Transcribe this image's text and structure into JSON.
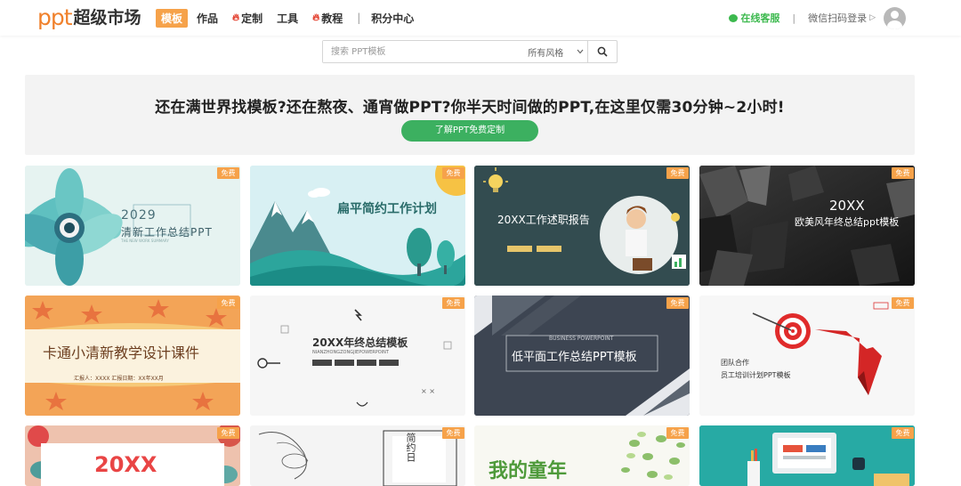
{
  "header": {
    "logo_ppt": "ppt",
    "logo_name": "超级市场",
    "nav": [
      {
        "label": "模板",
        "active": true,
        "hot": false
      },
      {
        "label": "作品",
        "active": false,
        "hot": false
      },
      {
        "label": "定制",
        "active": false,
        "hot": true
      },
      {
        "label": "工具",
        "active": false,
        "hot": false
      },
      {
        "label": "教程",
        "active": false,
        "hot": true
      },
      {
        "label": "积分中心",
        "active": false,
        "hot": false
      }
    ],
    "service_label": "在线客服",
    "separator": "|",
    "login_label": "微信扫码登录",
    "login_arrow": "▷"
  },
  "search": {
    "placeholder": "搜索 PPT模板",
    "style_select": "所有风格"
  },
  "banner": {
    "title": "还在满世界找模板?还在熬夜、通宵做PPT?你半天时间做的PPT,在这里仅需30分钟~2小时!",
    "button_label": "了解PPT免费定制"
  },
  "badge_label": "免费",
  "cards": [
    {
      "title": "2029",
      "subtitle": "清新工作总结PPT",
      "extra": "THE NEW WORK SUMMARY"
    },
    {
      "title": "扁平简约工作计划",
      "subtitle": "",
      "extra": ""
    },
    {
      "title": "20XX工作述职报告",
      "subtitle": "",
      "extra": ""
    },
    {
      "title": "20XX",
      "subtitle": "欧美风年终总结ppt模板",
      "extra": ""
    },
    {
      "title": "卡通小清新教学设计课件",
      "subtitle": "汇报人：XXXX    汇报日期：XX年XX月",
      "extra": ""
    },
    {
      "title": "20XX年终总结模板",
      "subtitle": "NIANZHONGZONGJIEPOWERPOINT",
      "extra": ""
    },
    {
      "title": "低平面工作总结PPT模板",
      "subtitle": "BUSINESS POWERPOINT",
      "extra": ""
    },
    {
      "title": "团队合作",
      "subtitle": "员工培训计划PPT模板",
      "extra": ""
    },
    {
      "title": "20XX",
      "subtitle": "",
      "extra": ""
    },
    {
      "title": "简约日",
      "subtitle": "",
      "extra": ""
    },
    {
      "title": "我的童年",
      "subtitle": "",
      "extra": ""
    },
    {
      "title": "",
      "subtitle": "",
      "extra": ""
    }
  ],
  "colors": {
    "accent_orange": "#f6a24a",
    "logo_orange": "#f0812c",
    "green": "#3cb060",
    "hot_red": "#e3402f"
  }
}
